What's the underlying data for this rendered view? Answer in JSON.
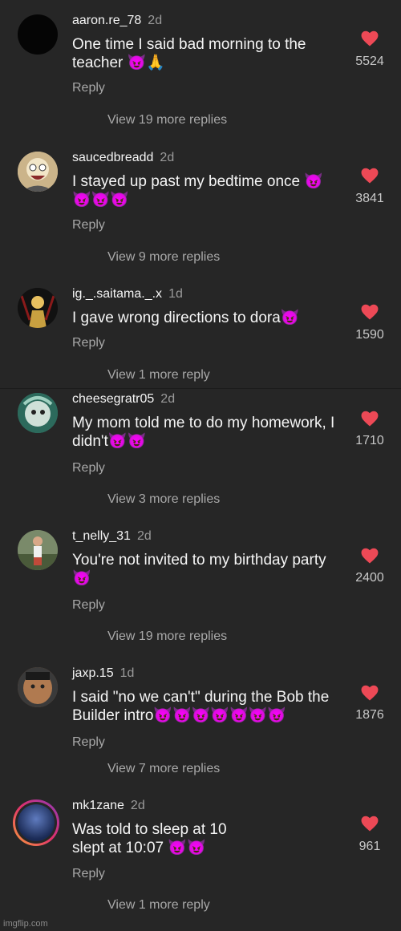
{
  "comments": [
    {
      "username": "aaron.re_78",
      "age": "2d",
      "text": "One time I said bad morning to the teacher 😈🙏",
      "reply": "Reply",
      "more": "View 19 more replies",
      "likes": "5524",
      "avatar_color": "#0a0a0a"
    },
    {
      "username": "saucedbreadd",
      "age": "2d",
      "text": "I stayed up past my bedtime once 😈 😈😈😈",
      "reply": "Reply",
      "more": "View 9 more replies",
      "likes": "3841",
      "avatar_color": "#e8d8b8"
    },
    {
      "username": "ig._.saitama._.x",
      "age": "1d",
      "text": "I gave wrong directions to dora😈",
      "reply": "Reply",
      "more": "View 1 more reply",
      "likes": "1590",
      "avatar_color": "#2a2a2a"
    },
    {
      "username": "cheesegratr05",
      "age": "2d",
      "text": "My mom told me to do my homework, I didn't😈😈",
      "reply": "Reply",
      "more": "View 3 more replies",
      "likes": "1710",
      "avatar_color": "#4a8a7a"
    },
    {
      "username": "t_nelly_31",
      "age": "2d",
      "text": "You're not invited to my birthday party 😈",
      "reply": "Reply",
      "more": "View 19 more replies",
      "likes": "2400",
      "avatar_color": "#6a7a5a"
    },
    {
      "username": "jaxp.15",
      "age": "1d",
      "text": "I said \"no we can't\" during the Bob the Builder intro😈😈😈😈😈😈😈",
      "reply": "Reply",
      "more": "View 7 more replies",
      "likes": "1876",
      "avatar_color": "#a06a4a"
    },
    {
      "username": "mk1zane",
      "age": "2d",
      "text": "Was told to sleep at 10 slept at 10:07 😈😈",
      "reply": "Reply",
      "more": "View 1 more reply",
      "likes": "961",
      "avatar_color": "#3a5a9a"
    }
  ],
  "heart_color": "#ed4956",
  "watermark": "imgflip.com"
}
